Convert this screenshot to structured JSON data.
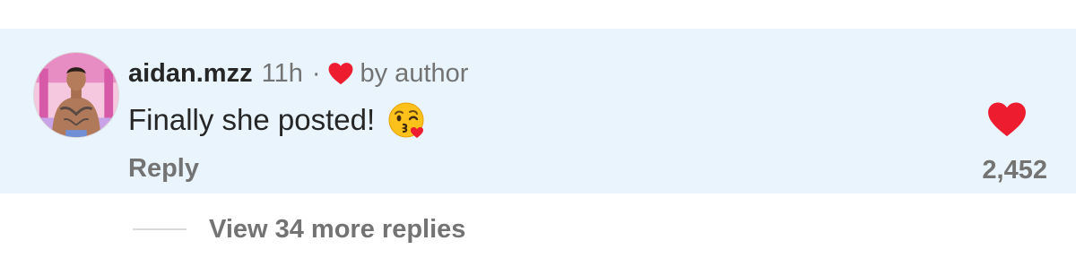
{
  "comment": {
    "username": "aidan.mzz",
    "timestamp": "11h",
    "separator": "·",
    "liked_by_author_label": "by author",
    "text": "Finally she posted!",
    "emoji": "face-throwing-a-kiss",
    "reply_label": "Reply",
    "like_count": "2,452",
    "liked": true
  },
  "replies": {
    "view_more_label": "View 34 more replies"
  },
  "colors": {
    "highlight_background": "#e9f4fd",
    "heart_red": "#ed1c2e",
    "username_text": "#262626",
    "secondary_text": "#737373",
    "divider": "#dbdbdb"
  },
  "icons": {
    "author_like": "heart-icon",
    "comment_like": "heart-icon",
    "avatar": "profile-photo"
  }
}
